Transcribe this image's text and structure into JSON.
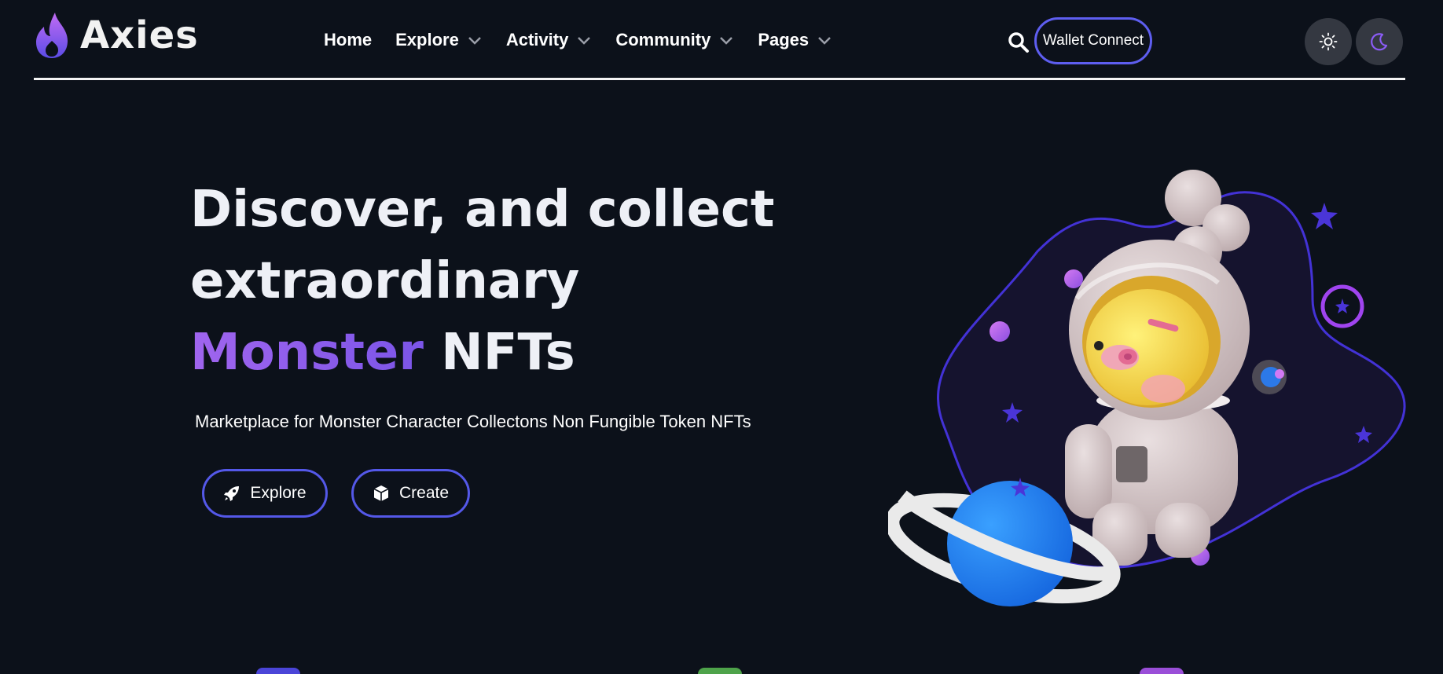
{
  "brand": {
    "name": "Axies"
  },
  "nav": {
    "items": [
      {
        "label": "Home",
        "has_dropdown": false
      },
      {
        "label": "Explore",
        "has_dropdown": true
      },
      {
        "label": "Activity",
        "has_dropdown": true
      },
      {
        "label": "Community",
        "has_dropdown": true
      },
      {
        "label": "Pages",
        "has_dropdown": true
      }
    ]
  },
  "header": {
    "search_icon": "search-icon",
    "wallet_button": "Wallet Connect",
    "theme_light_icon": "sun-icon",
    "theme_dark_icon": "moon-icon"
  },
  "hero": {
    "title_line1": "Discover, and collect",
    "title_line2": "extraordinary",
    "title_accent": "Monster",
    "title_end": "NFTs",
    "subtitle": "Marketplace for Monster Character Collectons Non Fungible Token NFTs",
    "buttons": {
      "explore": {
        "label": "Explore",
        "icon": "rocket-icon"
      },
      "create": {
        "label": "Create",
        "icon": "cube-icon"
      }
    }
  },
  "colors": {
    "background": "#0c111a",
    "accent_purple": "#8f5ff0",
    "button_border": "#5458e8",
    "theme_button_bg": "#343841"
  }
}
